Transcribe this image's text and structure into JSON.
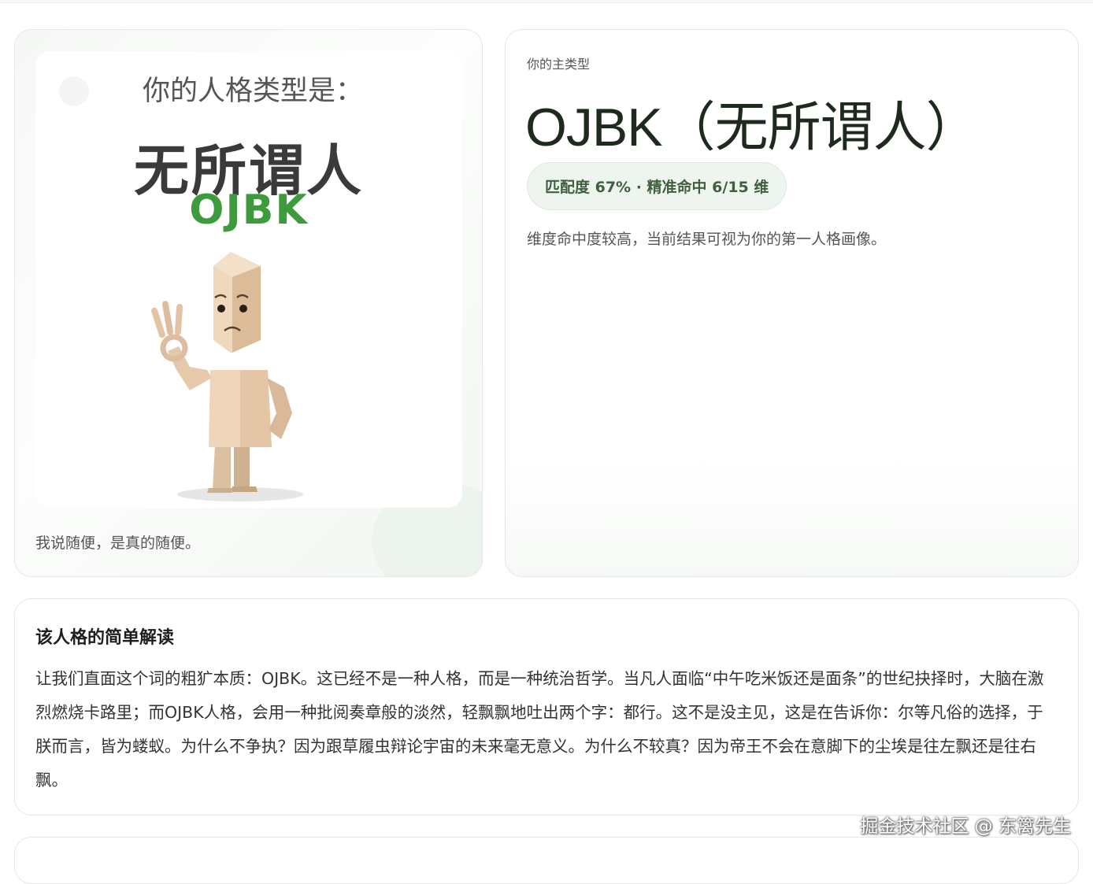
{
  "poster": {
    "prefix": "你的人格类型是：",
    "name": "无所谓人",
    "code": "OJBK",
    "caption": "我说随便，是真的随便。"
  },
  "main": {
    "kicker": "你的主类型",
    "title": "OJBK（无所谓人）",
    "match": "匹配度 67% · 精准命中 6/15 维",
    "note": "维度命中度较高，当前结果可视为你的第一人格画像。"
  },
  "reading": {
    "title": "该人格的简单解读",
    "body": "让我们直面这个词的粗犷本质：OJBK。这已经不是一种人格，而是一种统治哲学。当凡人面临“中午吃米饭还是面条”的世纪抉择时，大脑在激烈燃烧卡路里；而OJBK人格，会用一种批阅奏章般的淡然，轻飘飘地吐出两个字：都行。这不是没主见，这是在告诉你：尔等凡俗的选择，于朕而言，皆为蝼蚁。为什么不争执？因为跟草履虫辩论宇宙的未来毫无意义。为什么不较真？因为帝王不会在意脚下的尘埃是往左飘还是往右飘。"
  },
  "watermark": "掘金技术社区 @ 东篱先生",
  "colors": {
    "accent_green": "#3d9b3d",
    "pill_bg": "#eef4ee",
    "pill_text": "#3f5f3f"
  }
}
